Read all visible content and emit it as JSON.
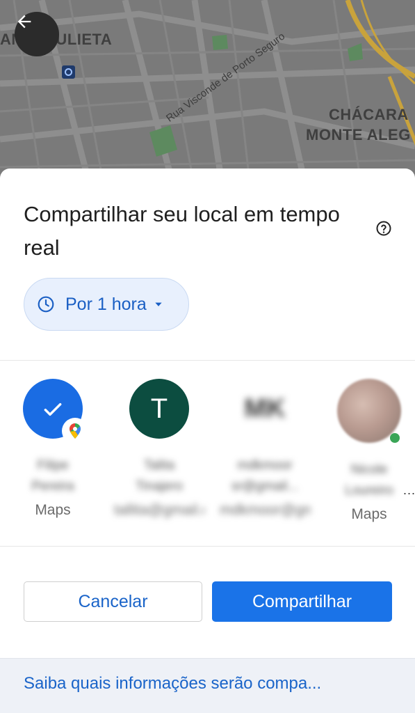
{
  "map": {
    "labels": [
      "ANJA JULIETA",
      "CHÁCARA",
      "MONTE ALEG"
    ],
    "street": "Rua Visconde de Porto Seguro"
  },
  "icons": {
    "back": "arrow-left-icon",
    "help": "help-circle-icon",
    "clock": "clock-icon",
    "caret": "caret-down-icon",
    "check": "check-icon",
    "maps_badge": "google-maps-pin-icon"
  },
  "sheet": {
    "title": "Compartilhar seu local em tempo real",
    "duration_label": "Por 1 hora"
  },
  "contacts": [
    {
      "avatar_initial": "",
      "name_line1": "Filipe",
      "name_line2": "Pereira",
      "sub_label": "Maps",
      "selected": true
    },
    {
      "avatar_initial": "T",
      "name_line1": "Talita",
      "name_line2": "Tinajero",
      "sub_label": "tallita@gmail.com",
      "selected": false
    },
    {
      "avatar_text": "MK",
      "name_line1": "mdkmoor",
      "name_line2": "sr@gmail...",
      "sub_label": "mdkmoor@gmail",
      "selected": false
    },
    {
      "avatar_initial": "",
      "name_line1": "Nicole",
      "name_line2": "Loureiro",
      "sub_label": "Maps",
      "selected": false
    }
  ],
  "more_indicator": "...",
  "buttons": {
    "cancel": "Cancelar",
    "share": "Compartilhar"
  },
  "footer": {
    "link_text": "Saiba quais informações serão compa..."
  },
  "colors": {
    "accent": "#1a73e8",
    "chip_bg": "#e8f0fd",
    "teal_avatar": "#0c4d40"
  }
}
